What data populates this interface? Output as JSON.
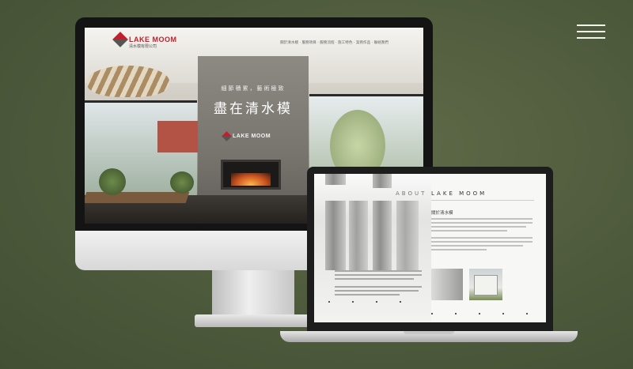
{
  "menu": {
    "icon": "hamburger-menu-icon"
  },
  "desktop_site": {
    "logo_text": "LAKE MOOM",
    "logo_subtext": "清水模有限公司",
    "nav_items": [
      "關於清水模",
      "服務項目",
      "服務流程",
      "施工特色",
      "案例作品",
      "聯絡我們"
    ],
    "hero_subtitle": "細節積累，藝術極致",
    "hero_title": "盡在清水模",
    "hero_logo_text": "LAKE MOOM"
  },
  "laptop_site": {
    "about_label": "ABOUT",
    "brand_label": "LAKE MOOM",
    "section_heading": "關於清水模"
  },
  "colors": {
    "background": "#4e5a3c",
    "brand_red": "#c0202c"
  }
}
